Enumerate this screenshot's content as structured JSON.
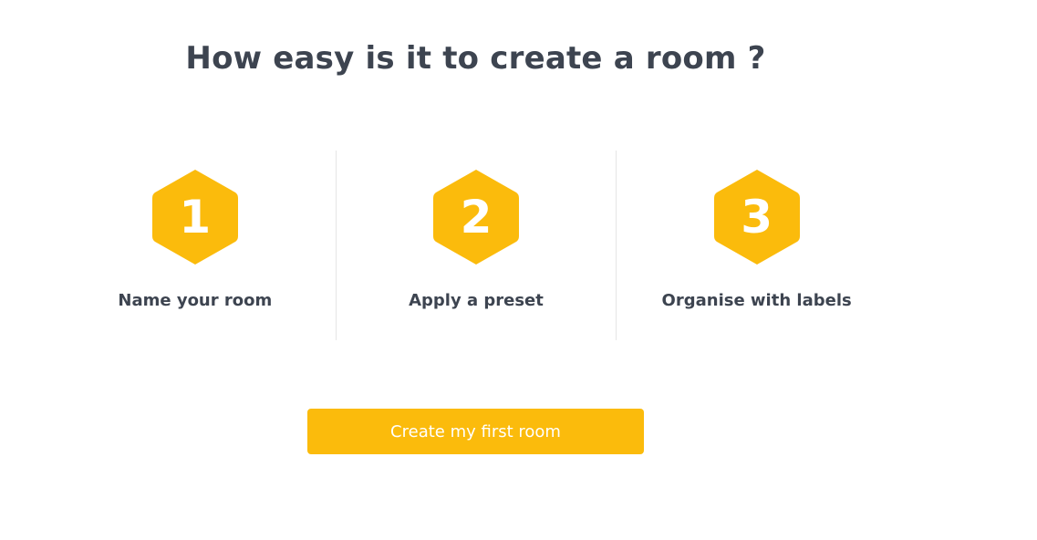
{
  "page": {
    "title": "How easy is it to create a room ?"
  },
  "colors": {
    "accent": "#fbbb0c",
    "text": "#3d4450",
    "divider": "#e6e6e6",
    "background": "#ffffff"
  },
  "steps": [
    {
      "number": "1",
      "label": "Name your room",
      "icon": "hexagon-icon"
    },
    {
      "number": "2",
      "label": "Apply a preset",
      "icon": "hexagon-icon"
    },
    {
      "number": "3",
      "label": "Organise with labels",
      "icon": "hexagon-icon"
    }
  ],
  "cta": {
    "label": "Create my first room"
  }
}
